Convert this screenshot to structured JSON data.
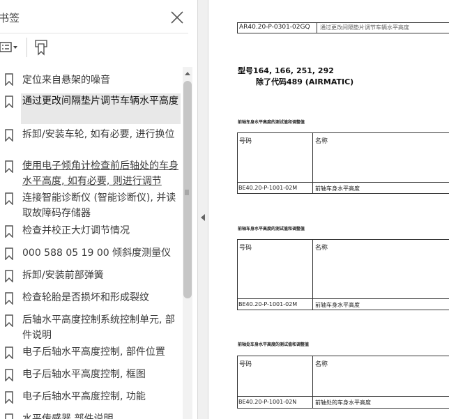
{
  "sidebar": {
    "title": "书签",
    "close_icon": "close-icon",
    "options_icon": "list-options-icon",
    "tag_icon": "bookmark-tag-icon",
    "items": [
      {
        "label": "定位来自悬架的噪音"
      },
      {
        "label": "通过更改间隔垫片调节车辆水平高度"
      },
      {
        "label": "拆卸/安装车轮, 如有必要, 进行换位"
      },
      {
        "label": "使用电子倾角计检查前后轴处的车身水平高度, 如有必要, 则进行调节"
      },
      {
        "label": "连接智能诊断仪 (智能诊断仪), 并读取故障码存储器"
      },
      {
        "label": "检查并校正大灯调节情况"
      },
      {
        "label": "000 588 05 19 00 倾斜度测量仪"
      },
      {
        "label": "拆卸/安装前部弹簧"
      },
      {
        "label": "检查轮胎是否损坏和形成裂纹"
      },
      {
        "label": "后轴水平高度控制系统控制单元, 部件说明"
      },
      {
        "label": "电子后轴水平高度控制, 部件位置"
      },
      {
        "label": "电子后轴水平高度控制, 框图"
      },
      {
        "label": "电子后轴水平高度控制, 功能"
      },
      {
        "label": "水平传感器 部件说明"
      }
    ]
  },
  "document": {
    "top_code": "AR40.20-P-0301-02GQ",
    "top_title": "通过更改间隔垫片调节车辆水平高度",
    "model_line": "型号164, 166, 251, 292",
    "model_sub": "除了代码489 (AIRMATIC)",
    "sections": [
      {
        "heading": "前轴车身水平高度的测试值和调整值",
        "col1": "号码",
        "col2": "名称",
        "code": "BE40.20-P-1001-02M",
        "name": "前轴车身水平高度"
      },
      {
        "heading": "前轴车身水平高度的测试值和调整值",
        "col1": "号码",
        "col2": "名称",
        "code": "BE40.20-P-1001-02M",
        "name": "前轴车身水平高度"
      },
      {
        "heading": "前轴处车身水平高度的测试值和调整值",
        "col1": "号码",
        "col2": "名称",
        "code": "BE40.20-P-1001-02N",
        "name": "前轴处的车身水平高度"
      }
    ]
  }
}
